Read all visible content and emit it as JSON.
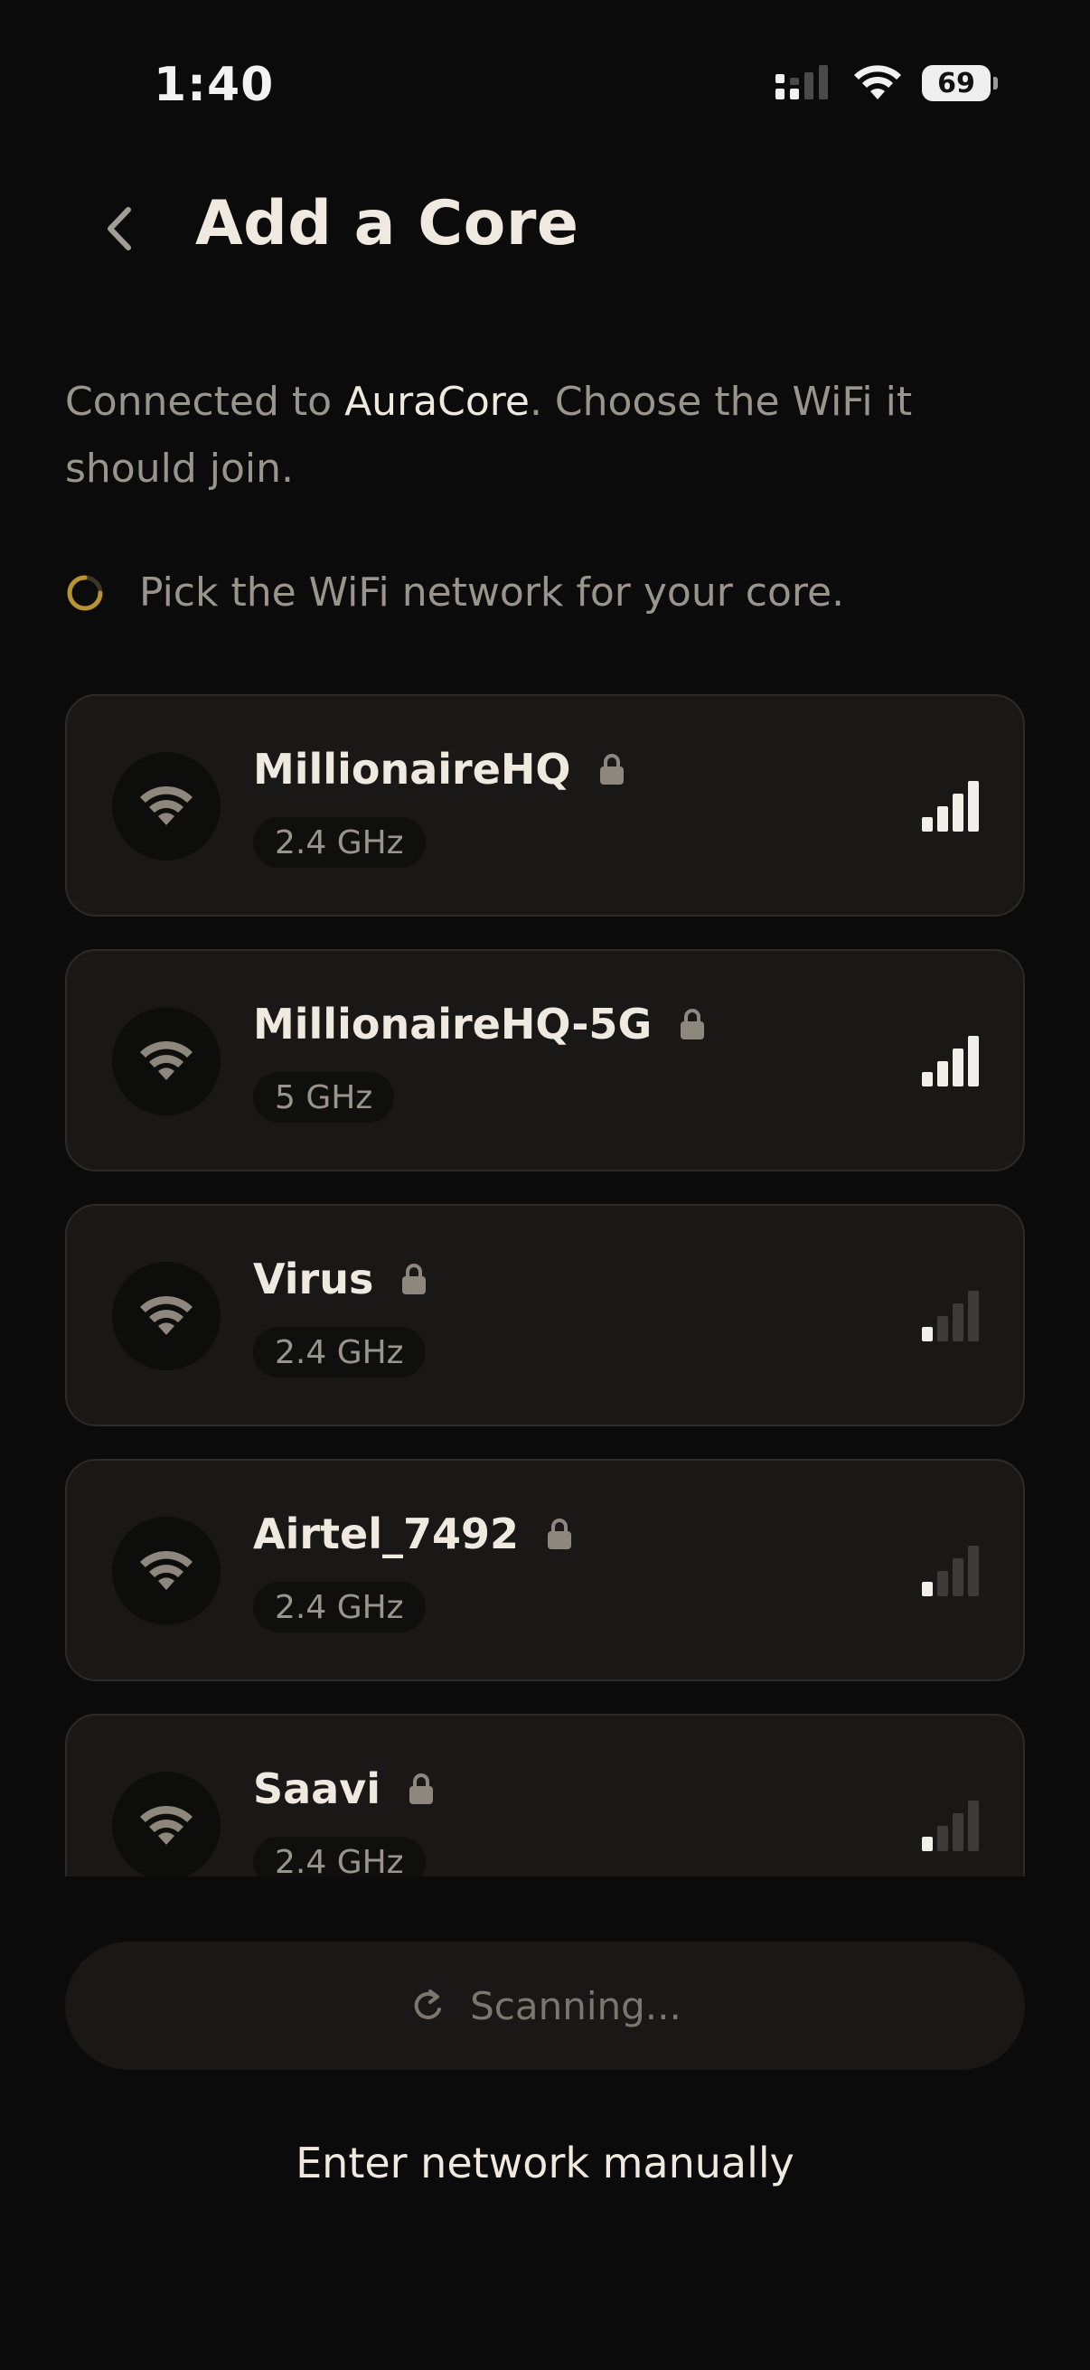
{
  "status_bar": {
    "time": "1:40",
    "battery": "69"
  },
  "header": {
    "title": "Add a Core"
  },
  "subtitle": {
    "prefix": "Connected to ",
    "device": "AuraCore",
    "suffix": ". Choose the WiFi it should join."
  },
  "hint": "Pick the WiFi network for your core.",
  "networks": [
    {
      "name": "MillionaireHQ",
      "band": "2.4 GHz",
      "strength": 4
    },
    {
      "name": "MillionaireHQ-5G",
      "band": "5 GHz",
      "strength": 4
    },
    {
      "name": "Virus",
      "band": "2.4 GHz",
      "strength": 1
    },
    {
      "name": "Airtel_7492",
      "band": "2.4 GHz",
      "strength": 1
    },
    {
      "name": "Saavi",
      "band": "2.4 GHz",
      "strength": 1
    }
  ],
  "scan_button": {
    "label": "Scanning..."
  },
  "manual_link": {
    "label": "Enter network manually"
  },
  "colors": {
    "background": "#0b0b0b",
    "card": "#191817",
    "accent": "#b8932f",
    "text": "#efe9df",
    "muted": "#9a958c"
  }
}
